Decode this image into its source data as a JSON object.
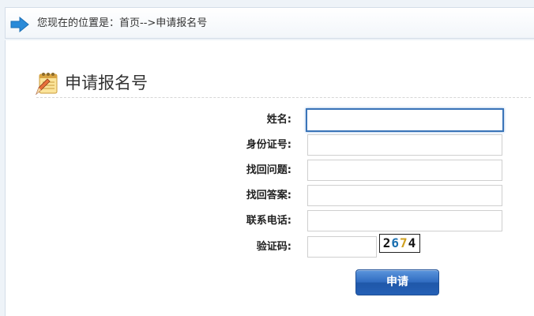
{
  "breadcrumb": {
    "prefix": "您现在的位置是：",
    "path": "首页-->申请报名号"
  },
  "page_title": "申请报名号",
  "form": {
    "fields": [
      {
        "label": "姓名:",
        "value": ""
      },
      {
        "label": "身份证号:",
        "value": ""
      },
      {
        "label": "找回问题:",
        "value": ""
      },
      {
        "label": "找回答案:",
        "value": ""
      },
      {
        "label": "联系电话:",
        "value": ""
      },
      {
        "label": "验证码:",
        "value": ""
      }
    ],
    "captcha": [
      "2",
      "6",
      "7",
      "4"
    ],
    "submit_label": "申请"
  },
  "colors": {
    "accent": "#2f6bc0",
    "focus_border": "#3a74b8",
    "arrow": "#2a8ad8"
  },
  "icons": {
    "breadcrumb": "arrow-right-icon",
    "title": "notepad-pencil-icon"
  }
}
